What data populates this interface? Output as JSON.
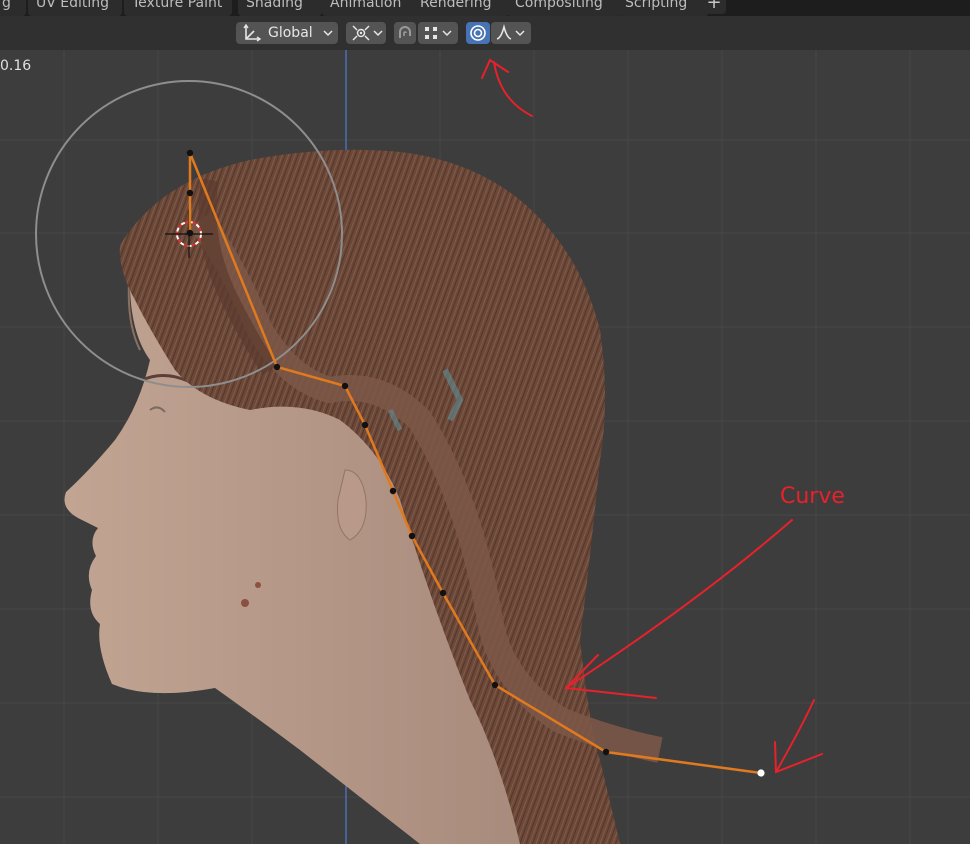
{
  "workspace_tabs": [
    {
      "label": "g",
      "active": false
    },
    {
      "label": "UV Editing",
      "active": false
    },
    {
      "label": "Texture Paint",
      "active": false
    },
    {
      "label": "Shading",
      "active": false
    },
    {
      "label": "Animation",
      "active": false
    },
    {
      "label": "Rendering",
      "active": false
    },
    {
      "label": "Compositing",
      "active": false
    },
    {
      "label": "Scripting",
      "active": false
    }
  ],
  "add_workspace_label": "+",
  "header": {
    "transform_orientation": "Global",
    "pivot_icon": "pivot-point-icon",
    "snap_icon": "snap-magnet-icon",
    "snap_target_icon": "snap-increment-icon",
    "proportional_icon": "proportional-editing-icon",
    "falloff_icon": "falloff-curve-icon",
    "proportional_editing_enabled": true
  },
  "viewport": {
    "readout_text": "0.16",
    "annotation_text": "Curve",
    "colors": {
      "background": "#3d3d3d",
      "curve": "#e07a1e",
      "annotation": "#e8212a",
      "hair": "#6e4a3b",
      "skin": "#b39684",
      "grid_axis": "#4a70b8"
    }
  }
}
